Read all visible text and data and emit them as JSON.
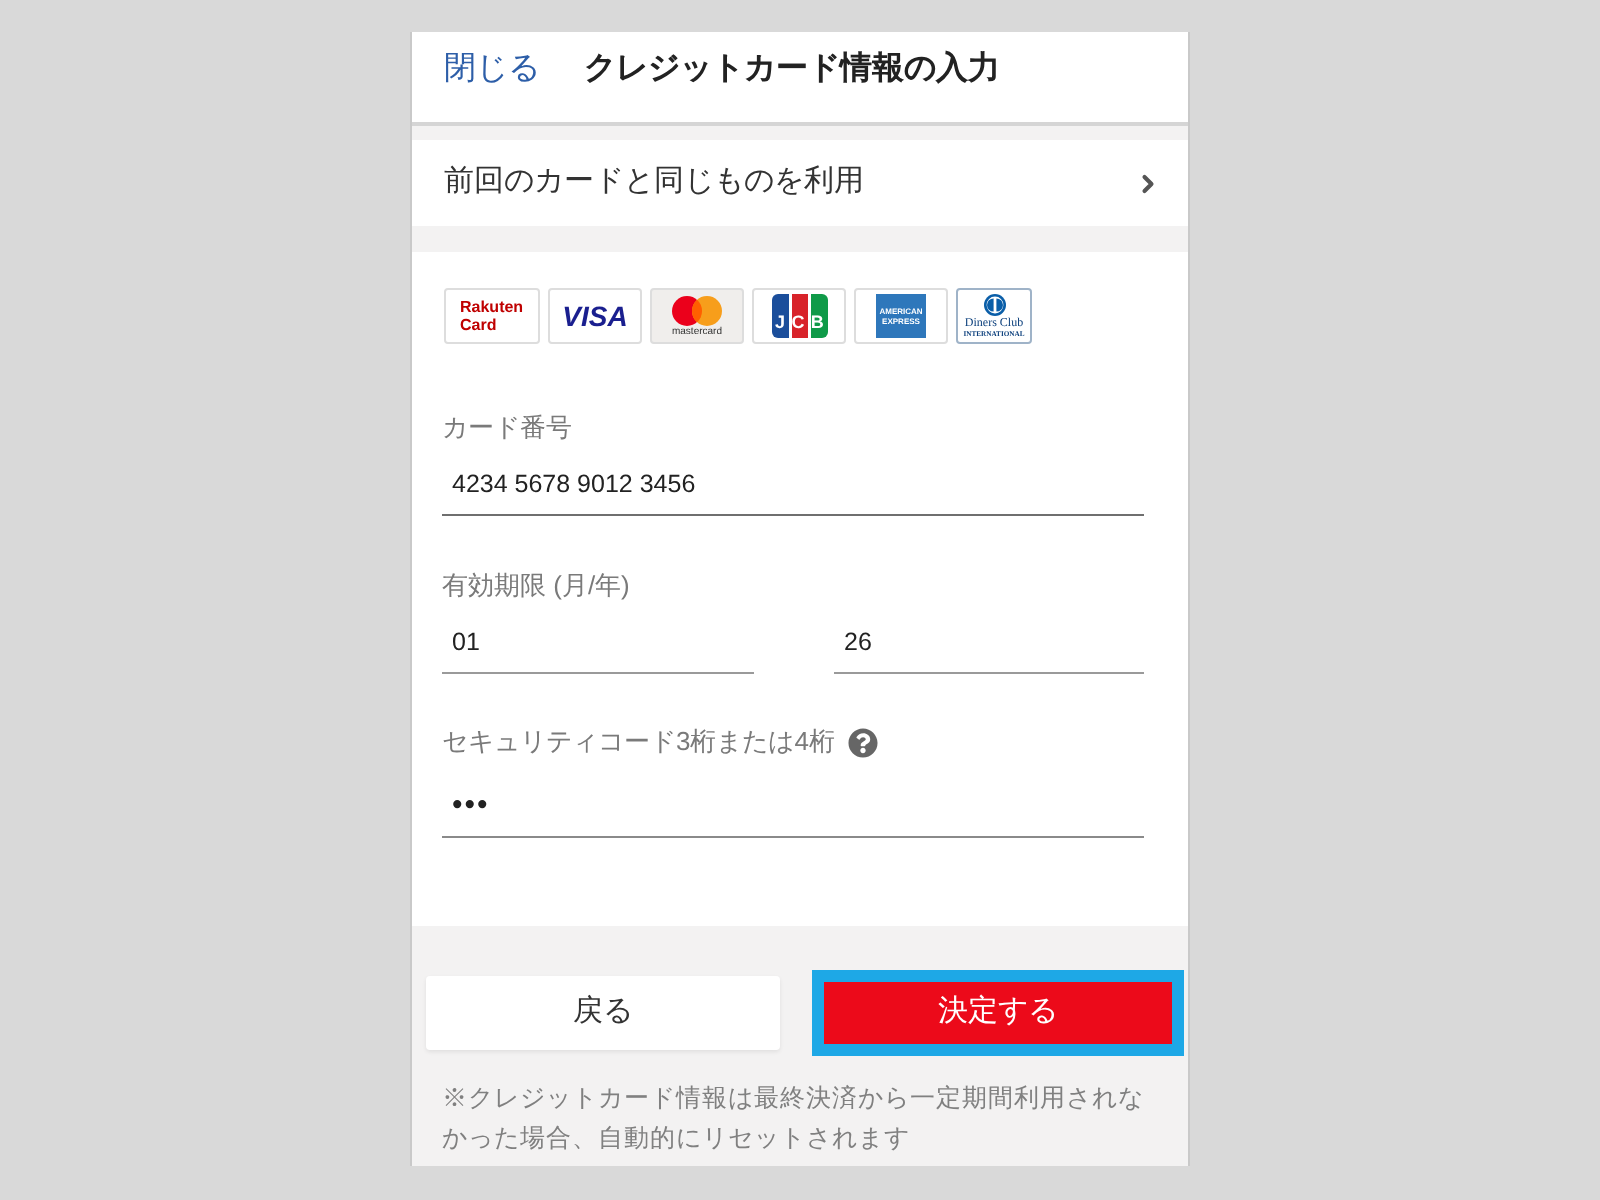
{
  "header": {
    "close_link": "閉じる",
    "title": "クレジットカード情報の入力"
  },
  "previous_card_row": {
    "label": "前回のカードと同じものを利用"
  },
  "card_brands": [
    {
      "kind": "rakuten",
      "lines": [
        "Rakuten",
        "Card"
      ]
    },
    {
      "kind": "visa",
      "lines": [
        "VISA"
      ]
    },
    {
      "kind": "mastercard",
      "lines": [
        "mastercard"
      ]
    },
    {
      "kind": "jcb",
      "lines": [
        "JCB"
      ]
    },
    {
      "kind": "amex",
      "lines": [
        "AMERICAN",
        "EXPRESS"
      ]
    },
    {
      "kind": "diners",
      "lines": [
        "Diners Club",
        "INTERNATIONAL"
      ]
    }
  ],
  "form": {
    "card_number": {
      "label": "カード番号",
      "value": "4234 5678 9012 3456"
    },
    "expiry": {
      "label": "有効期限 (月/年)",
      "month": "01",
      "year": "26"
    },
    "security_code": {
      "label": "セキュリティコード3桁または4桁",
      "value": "•••"
    }
  },
  "buttons": [
    {
      "kind": "secondary",
      "label": "戻る",
      "focused": false
    },
    {
      "kind": "primary",
      "label": "決定する",
      "focused": true
    }
  ],
  "note": "※クレジットカード情報は最終決済から一定期間利用されなかった場合、自動的にリセットされます"
}
